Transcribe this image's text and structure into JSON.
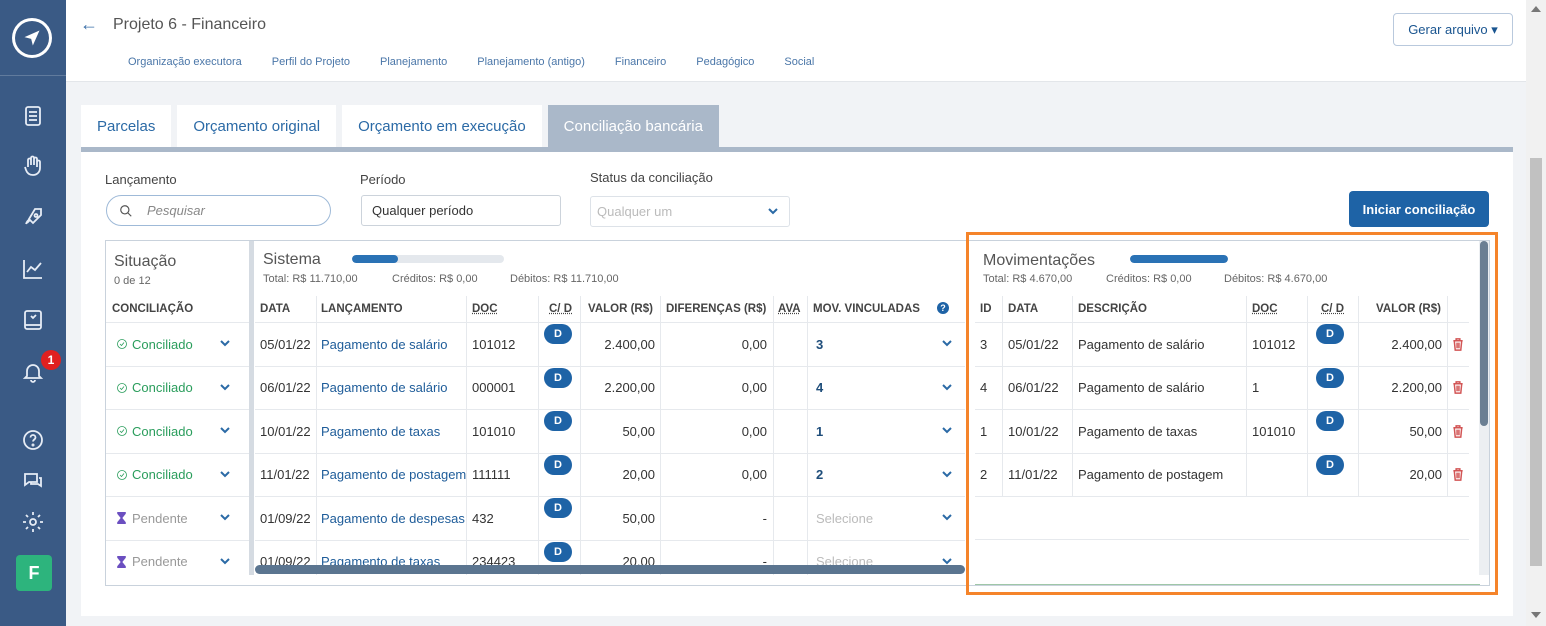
{
  "header": {
    "title": "Projeto 6 - Financeiro",
    "subnav": [
      "Organização executora",
      "Perfil do Projeto",
      "Planejamento",
      "Planejamento (antigo)",
      "Financeiro",
      "Pedagógico",
      "Social"
    ],
    "gerar_label": "Gerar arquivo ▾"
  },
  "sidebar": {
    "notification_count": "1",
    "avatar_letter": "F"
  },
  "tabs": [
    "Parcelas",
    "Orçamento original",
    "Orçamento em execução",
    "Conciliação bancária"
  ],
  "filters": {
    "lancamento_label": "Lançamento",
    "search_placeholder": "Pesquisar",
    "periodo_label": "Período",
    "periodo_value": "Qualquer período",
    "status_label": "Status da conciliação",
    "status_value": "Qualquer um",
    "iniciar_label": "Iniciar conciliação"
  },
  "situacao": {
    "title": "Situação",
    "count": "0 de 12",
    "header": "CONCILIAÇÃO"
  },
  "sistema": {
    "title": "Sistema",
    "progress": 0.3,
    "total": "Total: R$ 11.710,00",
    "creditos": "Créditos: R$ 0,00",
    "debitos": "Débitos: R$ 11.710,00",
    "headers": [
      "DATA",
      "LANÇAMENTO",
      "DOC",
      "C/ D",
      "VALOR (R$)",
      "DIFERENÇAS (R$)",
      "AVA",
      "MOV. VINCULADAS"
    ],
    "rows": [
      {
        "status": "Conciliado",
        "data": "05/01/22",
        "lancamento": "Pagamento de salário",
        "doc": "101012",
        "cd": "D",
        "valor": "2.400,00",
        "dif": "0,00",
        "mov": "3"
      },
      {
        "status": "Conciliado",
        "data": "06/01/22",
        "lancamento": "Pagamento de salário",
        "doc": "000001",
        "cd": "D",
        "valor": "2.200,00",
        "dif": "0,00",
        "mov": "4"
      },
      {
        "status": "Conciliado",
        "data": "10/01/22",
        "lancamento": "Pagamento de taxas",
        "doc": "101010",
        "cd": "D",
        "valor": "50,00",
        "dif": "0,00",
        "mov": "1"
      },
      {
        "status": "Conciliado",
        "data": "11/01/22",
        "lancamento": "Pagamento de postagem",
        "doc": "111111",
        "cd": "D",
        "valor": "20,00",
        "dif": "0,00",
        "mov": "2"
      },
      {
        "status": "Pendente",
        "data": "01/09/22",
        "lancamento": "Pagamento de despesas",
        "doc": "432",
        "cd": "D",
        "valor": "50,00",
        "dif": "-",
        "mov": "Selecione"
      },
      {
        "status": "Pendente",
        "data": "01/09/22",
        "lancamento": "Pagamento de taxas",
        "doc": "234423",
        "cd": "D",
        "valor": "20,00",
        "dif": "-",
        "mov": "Selecione"
      }
    ]
  },
  "movimentacoes": {
    "title": "Movimentações",
    "progress": 1.0,
    "total": "Total: R$ 4.670,00",
    "creditos": "Créditos: R$ 0,00",
    "debitos": "Débitos: R$ 4.670,00",
    "headers": [
      "ID",
      "DATA",
      "DESCRIÇÃO",
      "DOC",
      "C/ D",
      "VALOR (R$)"
    ],
    "rows": [
      {
        "id": "3",
        "data": "05/01/22",
        "descricao": "Pagamento de salário",
        "doc": "101012",
        "cd": "D",
        "valor": "2.400,00"
      },
      {
        "id": "4",
        "data": "06/01/22",
        "descricao": "Pagamento de salário",
        "doc": "1",
        "cd": "D",
        "valor": "2.200,00"
      },
      {
        "id": "1",
        "data": "10/01/22",
        "descricao": "Pagamento de taxas",
        "doc": "101010",
        "cd": "D",
        "valor": "50,00"
      },
      {
        "id": "2",
        "data": "11/01/22",
        "descricao": "Pagamento de postagem",
        "doc": "",
        "cd": "D",
        "valor": "20,00"
      }
    ]
  },
  "colors": {
    "sidebar": "#3a5a85",
    "accent": "#1e63a6",
    "highlight": "#f5842a",
    "success": "#2a9d5c"
  }
}
